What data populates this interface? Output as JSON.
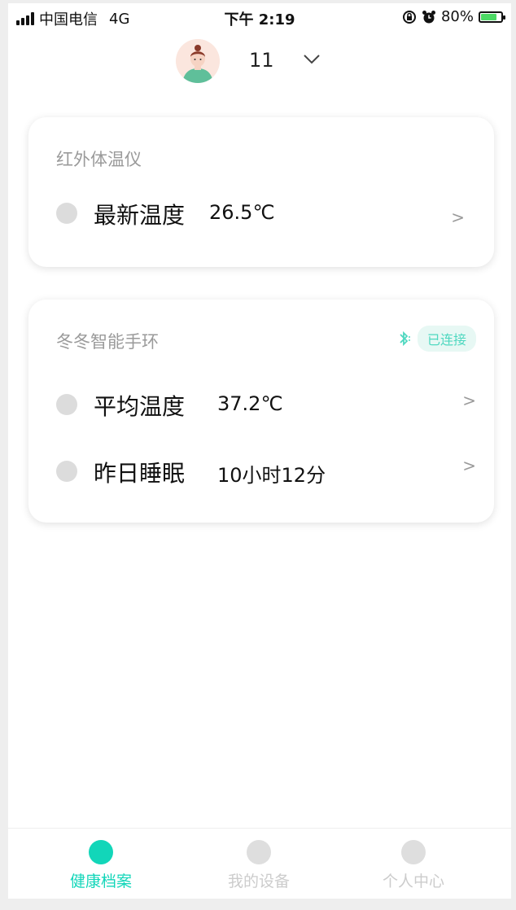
{
  "status_bar": {
    "carrier": "中国电信",
    "network": "4G",
    "time": "下午 2:19",
    "battery": "80%",
    "battery_level": 0.8
  },
  "user": {
    "name": "11"
  },
  "cards": {
    "infrared": {
      "title": "红外体温仪",
      "rows": [
        {
          "label": "最新温度",
          "value": "26.5℃",
          "arrow": ">"
        }
      ]
    },
    "band": {
      "title": "冬冬智能手环",
      "connection_badge": "已连接",
      "rows": [
        {
          "label": "平均温度",
          "value": "37.2℃",
          "arrow": ">"
        },
        {
          "label": "昨日睡眠",
          "value": "10小时12分",
          "arrow": ">"
        }
      ]
    }
  },
  "tabs": [
    {
      "label": "健康档案",
      "active": true
    },
    {
      "label": "我的设备",
      "active": false
    },
    {
      "label": "个人中心",
      "active": false
    }
  ],
  "colors": {
    "accent": "#12d6b9",
    "badge_bg": "#e7f8f4",
    "inactive": "#cccccc"
  }
}
